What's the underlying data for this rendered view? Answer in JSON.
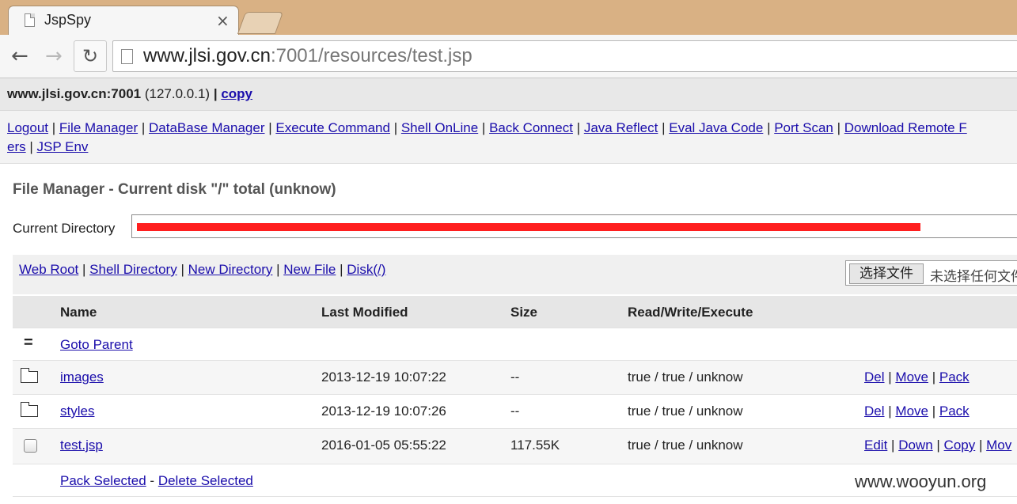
{
  "browser": {
    "tab_title": "JspSpy",
    "tab_close": "×",
    "url_host": "www.jlsi.gov.cn",
    "url_rest": ":7001/resources/test.jsp"
  },
  "host_bar": {
    "host": "www.jlsi.gov.cn:7001",
    "ip": "(127.0.0.1)",
    "sep": "|",
    "copy": "copy"
  },
  "menu": {
    "items": [
      "Logout",
      "File Manager",
      "DataBase Manager",
      "Execute Command",
      "Shell OnLine",
      "Back Connect",
      "Java Reflect",
      "Eval Java Code",
      "Port Scan",
      "Download Remote F"
    ],
    "line2_fragment": "ers",
    "line2_item": "JSP Env"
  },
  "file_manager": {
    "title": "File Manager - Current disk \"/\" total (unknow)",
    "current_dir_label": "Current Directory",
    "dir_links": [
      "Web Root",
      "Shell Directory",
      "New Directory",
      "New File",
      "Disk(/)"
    ],
    "choose_file": "选择文件",
    "no_file": "未选择任何文件"
  },
  "table": {
    "headers": {
      "name": "Name",
      "modified": "Last Modified",
      "size": "Size",
      "rwx": "Read/Write/Execute"
    },
    "parent": {
      "icon": "=",
      "label": "Goto Parent"
    },
    "rows": [
      {
        "name": "images",
        "modified": "2013-12-19 10:07:22",
        "size": "--",
        "rwx": "true / true / unknow",
        "actions": [
          "Del",
          "Move",
          "Pack"
        ]
      },
      {
        "name": "styles",
        "modified": "2013-12-19 10:07:26",
        "size": "--",
        "rwx": "true / true / unknow",
        "actions": [
          "Del",
          "Move",
          "Pack"
        ]
      },
      {
        "name": "test.jsp",
        "modified": "2016-01-05 05:55:22",
        "size": "117.55K",
        "rwx": "true / true / unknow",
        "actions": [
          "Edit",
          "Down",
          "Copy",
          "Mov"
        ]
      }
    ],
    "footer": {
      "pack_selected": "Pack Selected",
      "dash": "-",
      "delete_selected": "Delete Selected"
    }
  },
  "watermark": "www.wooyun.org"
}
